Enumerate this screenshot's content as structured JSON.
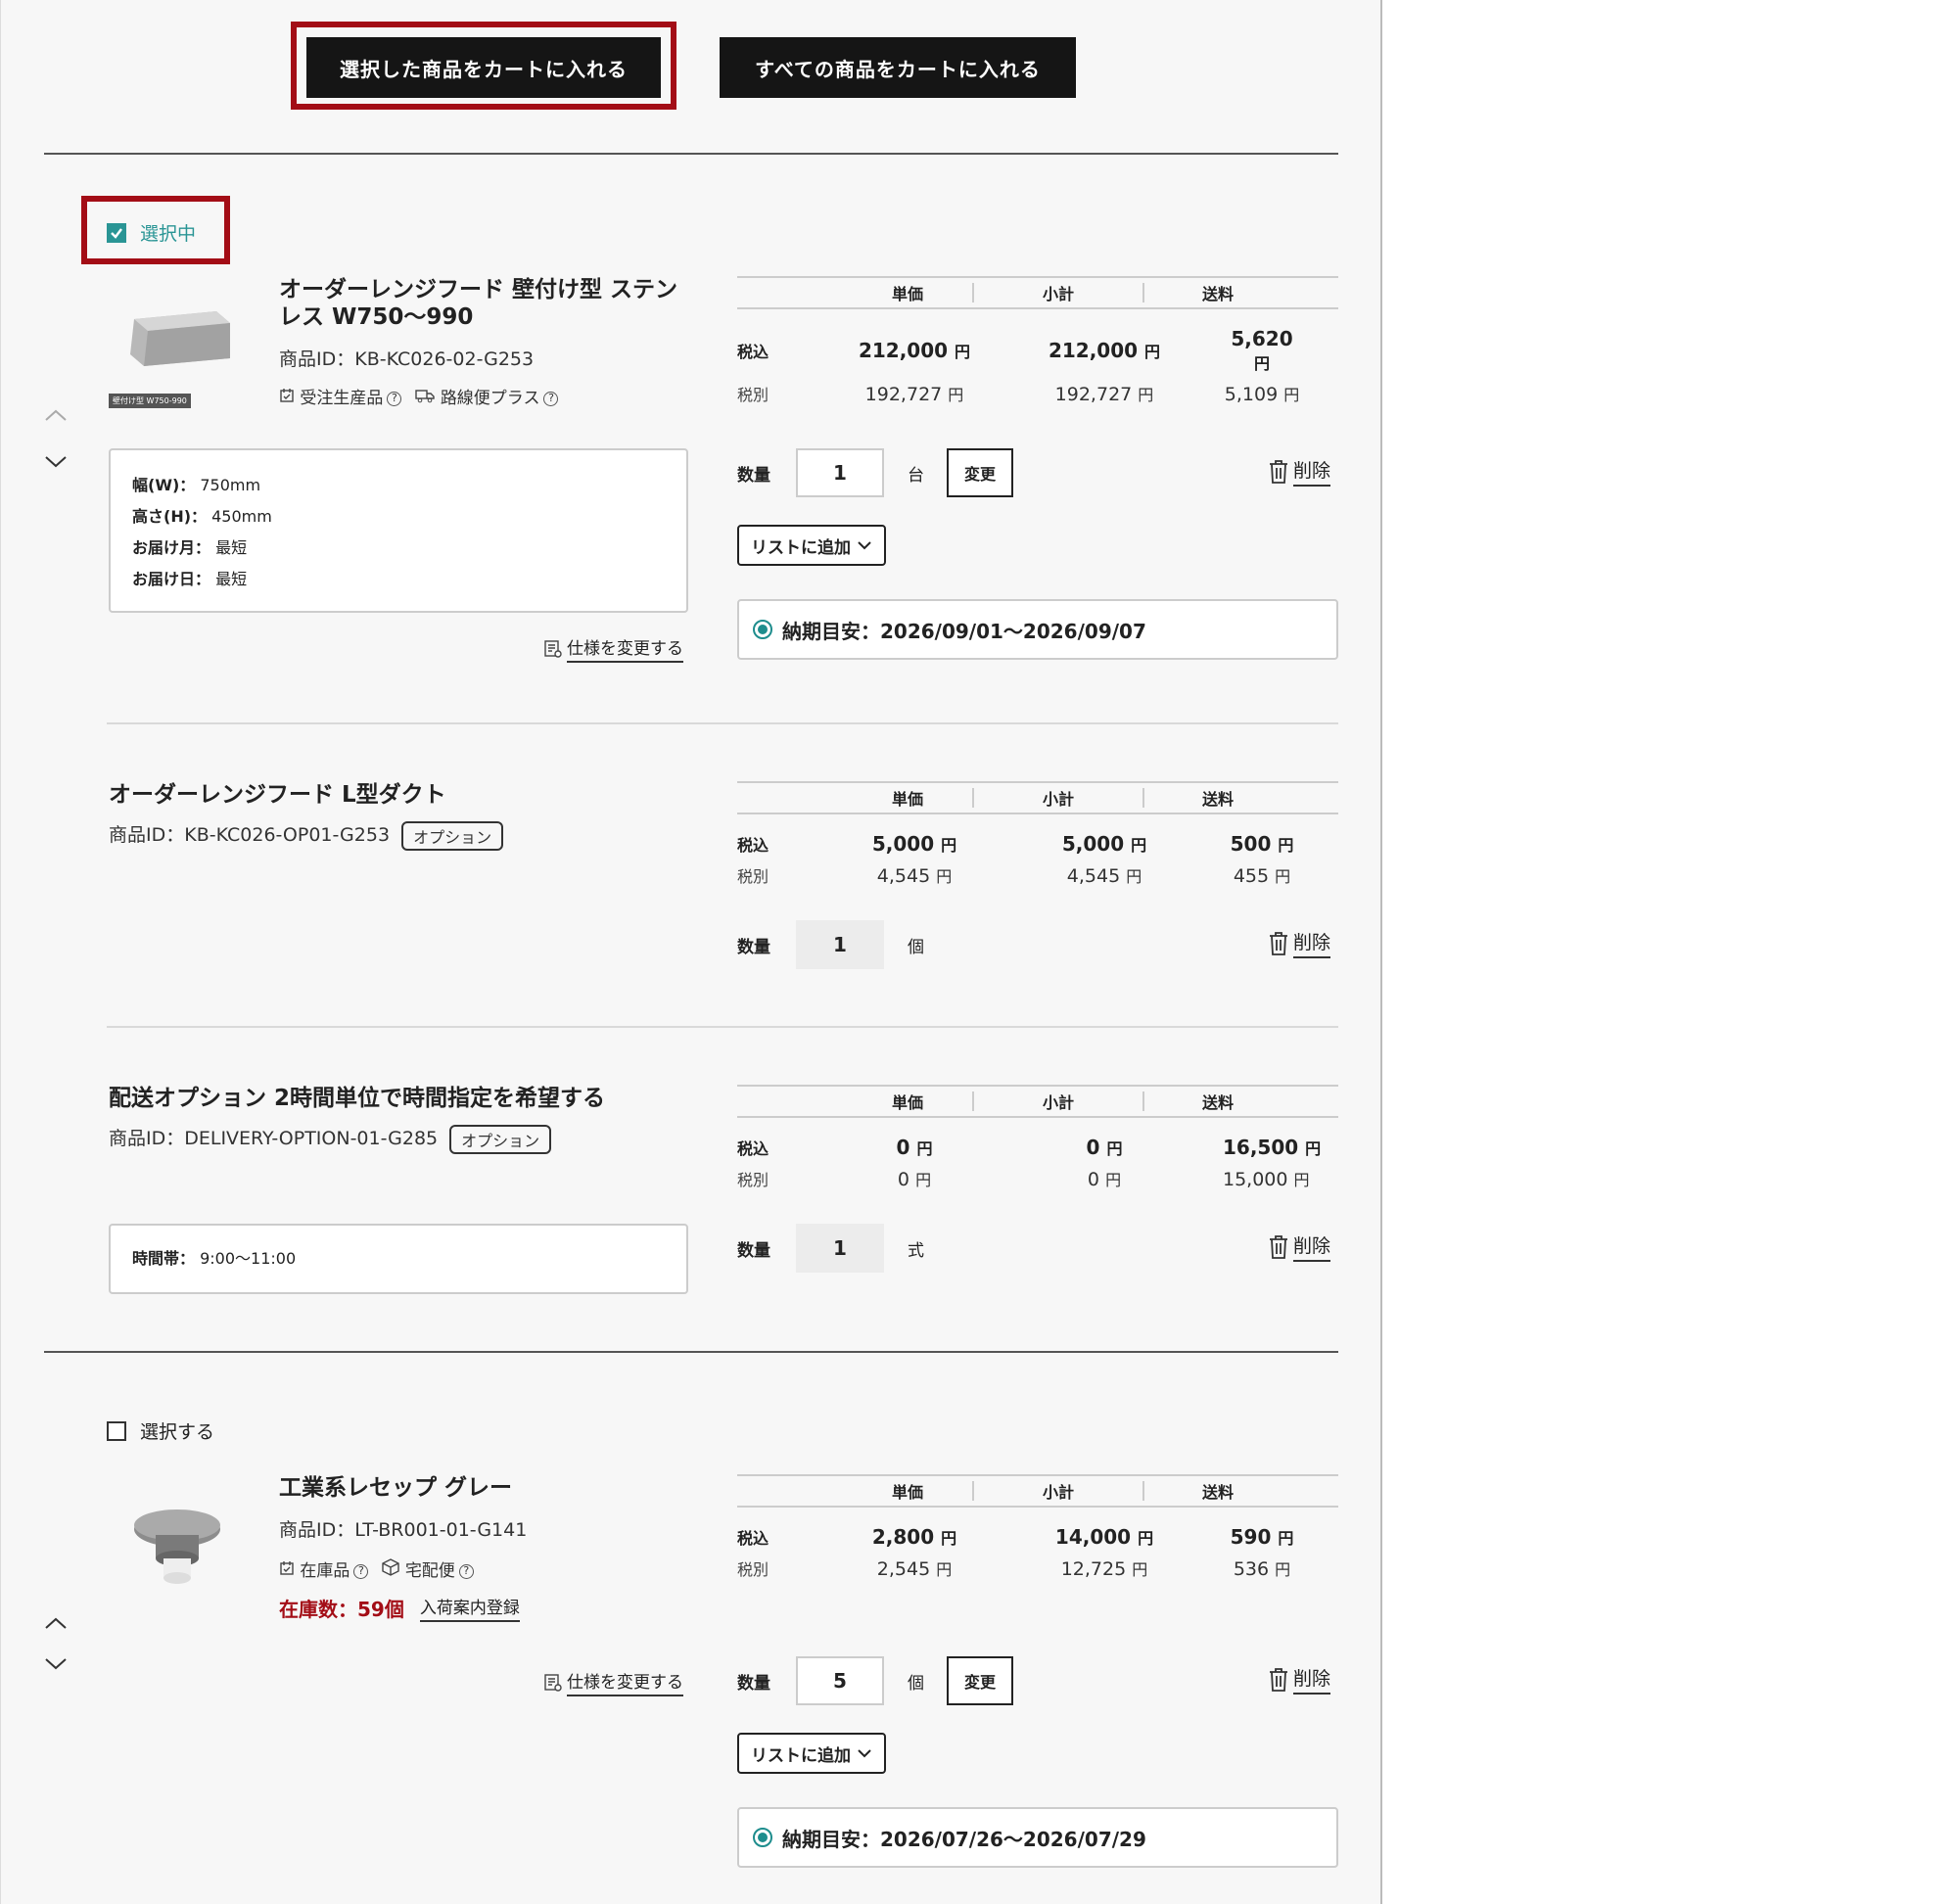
{
  "toolbar": {
    "add_selected": "選択した商品をカートに入れる",
    "add_all": "すべての商品をカートに入れる"
  },
  "headers": {
    "unit": "単価",
    "subtotal": "小計",
    "shipping": "送料"
  },
  "labels": {
    "tax_in": "税込",
    "tax_ex": "税別",
    "qty": "数量",
    "change": "変更",
    "delete": "削除",
    "add_to_list": "リストに追加",
    "change_spec": "仕様を変更する",
    "selected": "選択中",
    "select": "選択する",
    "option": "オプション",
    "yen": "円"
  },
  "items": [
    {
      "title_line1": "オーダーレンジフード 壁付け型 ステン",
      "title_line2": "レス W750〜990",
      "pid": "商品ID：KB-KC026-02-G253",
      "thumb_label": "壁付け型 W750-990",
      "badge1": "受注生産品",
      "badge2": "路線便プラス",
      "specs": [
        {
          "k": "幅(W)：",
          "v": "750mm"
        },
        {
          "k": "高さ(H)：",
          "v": "450mm"
        },
        {
          "k": "お届け月：",
          "v": "最短"
        },
        {
          "k": "お届け日：",
          "v": "最短"
        }
      ],
      "unit_in": "212,000",
      "sub_in": "212,000",
      "ship_in": "5,620",
      "unit_ex": "192,727",
      "sub_ex": "192,727",
      "ship_ex": "5,109",
      "qty": "1",
      "unit": "台",
      "eta": "納期目安：2026/09/01〜2026/09/07"
    },
    {
      "title": "オーダーレンジフード L型ダクト",
      "pid": "商品ID：KB-KC026-OP01-G253",
      "unit_in": "5,000",
      "sub_in": "5,000",
      "ship_in": "500",
      "unit_ex": "4,545",
      "sub_ex": "4,545",
      "ship_ex": "455",
      "qty": "1",
      "unit": "個"
    },
    {
      "title": "配送オプション 2時間単位で時間指定を希望する",
      "pid": "商品ID：DELIVERY-OPTION-01-G285",
      "spec_k": "時間帯：",
      "spec_v": "9:00〜11:00",
      "unit_in": "0",
      "sub_in": "0",
      "ship_in": "16,500",
      "unit_ex": "0",
      "sub_ex": "0",
      "ship_ex": "15,000",
      "qty": "1",
      "unit": "式"
    },
    {
      "title": "工業系レセップ グレー",
      "pid": "商品ID：LT-BR001-01-G141",
      "badge1": "在庫品",
      "badge2": "宅配便",
      "stock": "在庫数：59個",
      "restock": "入荷案内登録",
      "unit_in": "2,800",
      "sub_in": "14,000",
      "ship_in": "590",
      "unit_ex": "2,545",
      "sub_ex": "12,725",
      "ship_ex": "536",
      "qty": "5",
      "unit": "個",
      "eta": "納期目安：2026/07/26〜2026/07/29"
    }
  ],
  "colors": {
    "accent": "#2a9595",
    "highlight": "#a30d16",
    "stock": "#a30d16"
  }
}
